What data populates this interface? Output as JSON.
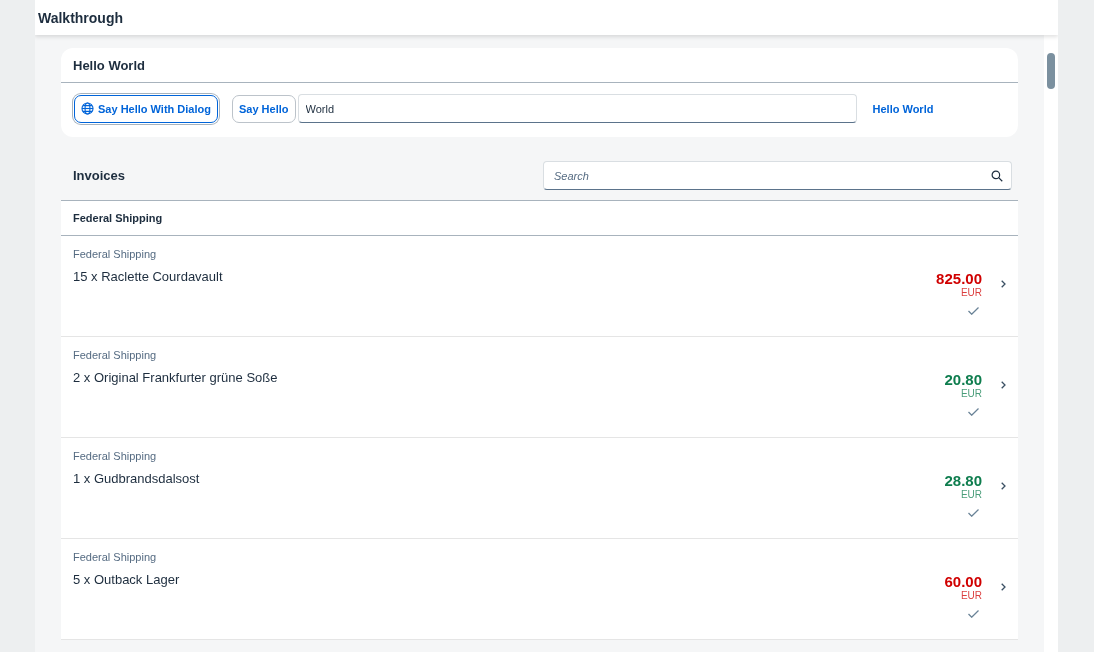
{
  "header": {
    "title": "Walkthrough"
  },
  "hello_panel": {
    "title": "Hello World",
    "dialog_button": "Say Hello With Dialog",
    "hello_button": "Say Hello",
    "name_field": {
      "value": "World"
    },
    "greeting_link": "Hello World"
  },
  "invoices": {
    "title": "Invoices",
    "search": {
      "placeholder": "Search"
    },
    "group_header": "Federal Shipping",
    "items": [
      {
        "shipper": "Federal Shipping",
        "title": "15 x Raclette Courdavault",
        "amount": "825.00",
        "currency": "EUR",
        "color": "#d00000"
      },
      {
        "shipper": "Federal Shipping",
        "title": "2 x Original Frankfurter grüne Soße",
        "amount": "20.80",
        "currency": "EUR",
        "color": "#0e7d4e"
      },
      {
        "shipper": "Federal Shipping",
        "title": "1 x Gudbrandsdalsost",
        "amount": "28.80",
        "currency": "EUR",
        "color": "#0e7d4e"
      },
      {
        "shipper": "Federal Shipping",
        "title": "5 x Outback Lager",
        "amount": "60.00",
        "currency": "EUR",
        "color": "#d00000"
      }
    ]
  }
}
